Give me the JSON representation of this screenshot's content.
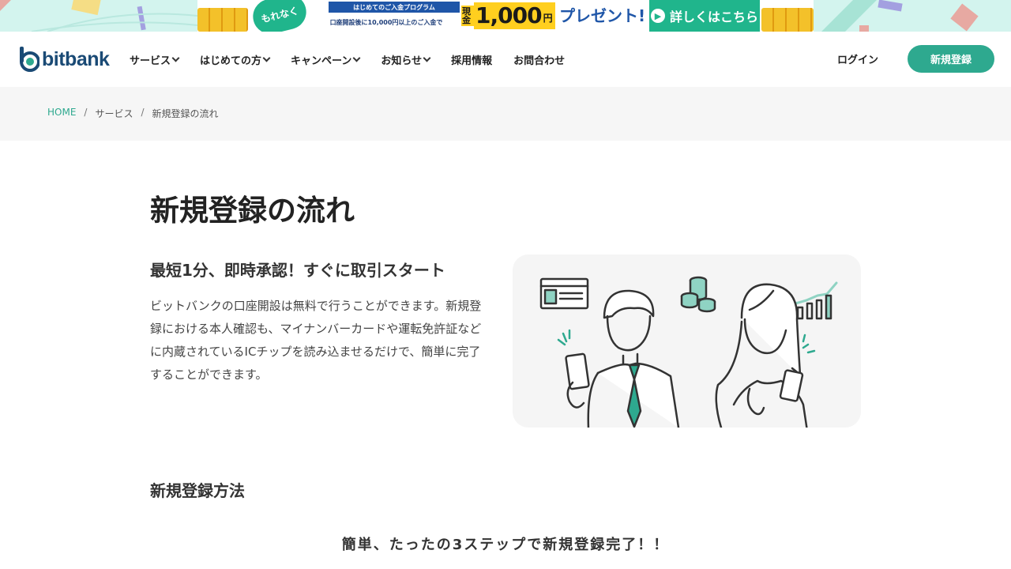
{
  "promo": {
    "badge": "もれなく",
    "program": "はじめてのご入金プログラム",
    "condition": "口座開設後に10,000円以上のご入金で",
    "cash_prefix": "現金",
    "amount": "1,000",
    "yen": "円",
    "present": "プレゼント!",
    "cta": "詳しくはこちら"
  },
  "header": {
    "logo_text": "bitbank",
    "nav": [
      {
        "label": "サービス",
        "dropdown": true
      },
      {
        "label": "はじめての方",
        "dropdown": true
      },
      {
        "label": "キャンペーン",
        "dropdown": true
      },
      {
        "label": "お知らせ",
        "dropdown": true
      },
      {
        "label": "採用情報",
        "dropdown": false
      },
      {
        "label": "お問合わせ",
        "dropdown": false
      }
    ],
    "login_label": "ログイン",
    "signup_label": "新規登録"
  },
  "breadcrumb": {
    "items": [
      "HOME",
      "サービス",
      "新規登録の流れ"
    ],
    "separator": "/"
  },
  "content": {
    "page_title": "新規登録の流れ",
    "lead_title": "最短1分、即時承認！すぐに取引スタート",
    "lead_text": "ビットバンクの口座開設は無料で行うことができます。新規登録における本人確認も、マイナンバーカードや運転免許証などに内蔵されているICチップを読み込ませるだけで、簡単に完了することができます。",
    "section_title": "新規登録方法",
    "steps_title": "簡単、たったの3ステップで新規登録完了！！"
  },
  "colors": {
    "accent": "#2ea98f",
    "logo": "#1a4a75",
    "breadcrumb_bg": "#f6f6f6"
  }
}
